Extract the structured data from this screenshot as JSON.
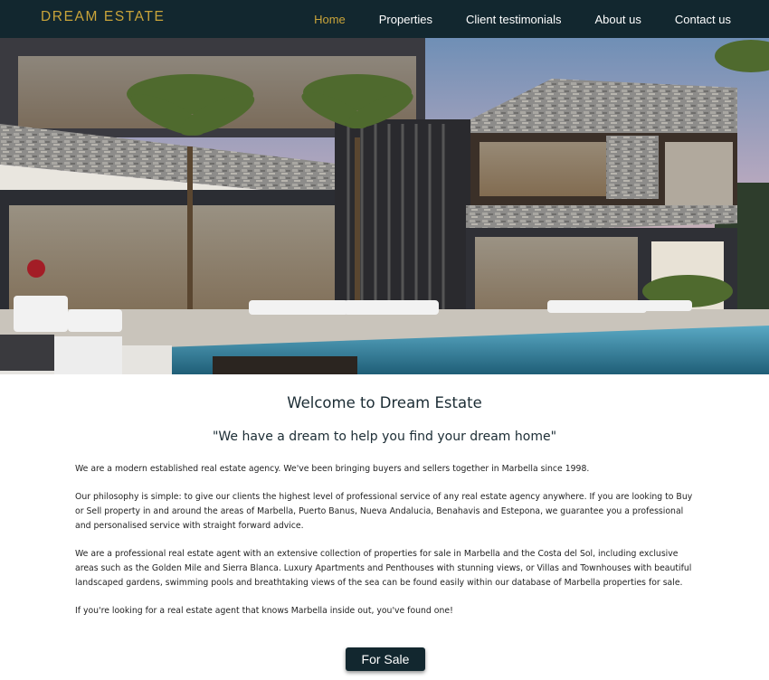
{
  "brand": {
    "logo": "DREAM ESTATE",
    "accent": "#c9a43a",
    "navbar_bg": "#12272f"
  },
  "nav": {
    "items": [
      {
        "label": "Home",
        "active": true
      },
      {
        "label": "Properties",
        "active": false
      },
      {
        "label": "Client testimonials",
        "active": false
      },
      {
        "label": "About us",
        "active": false
      },
      {
        "label": "Contact us",
        "active": false
      }
    ]
  },
  "hero": {
    "image": "luxury-villa-with-pool-photo"
  },
  "main": {
    "title": "Welcome to Dream Estate",
    "tagline": "\"We have a dream to help you find your dream home\"",
    "paragraphs": [
      "We are a modern established real estate agency. We've been bringing buyers and sellers together in Marbella since 1998.",
      "Our philosophy is simple: to give our clients the highest level of professional service of any real estate agency anywhere. If you are looking to Buy or Sell property in and around the areas of Marbella, Puerto Banus, Nueva Andalucia, Benahavis and Estepona, we guarantee you a professional and personalised service with straight forward advice.",
      "We are a professional real estate agent with an extensive collection of properties for sale in Marbella and the Costa del Sol, including exclusive areas such as the Golden Mile and Sierra Blanca. Luxury Apartments and Penthouses with stunning views, or Villas and Townhouses with beautiful landscaped gardens, swimming pools and breathtaking views of the sea can be found easily within our database of Marbella properties for sale.",
      "If you're looking for a real estate agent that knows Marbella inside out, you've found one!"
    ],
    "cta_label": "For Sale"
  }
}
